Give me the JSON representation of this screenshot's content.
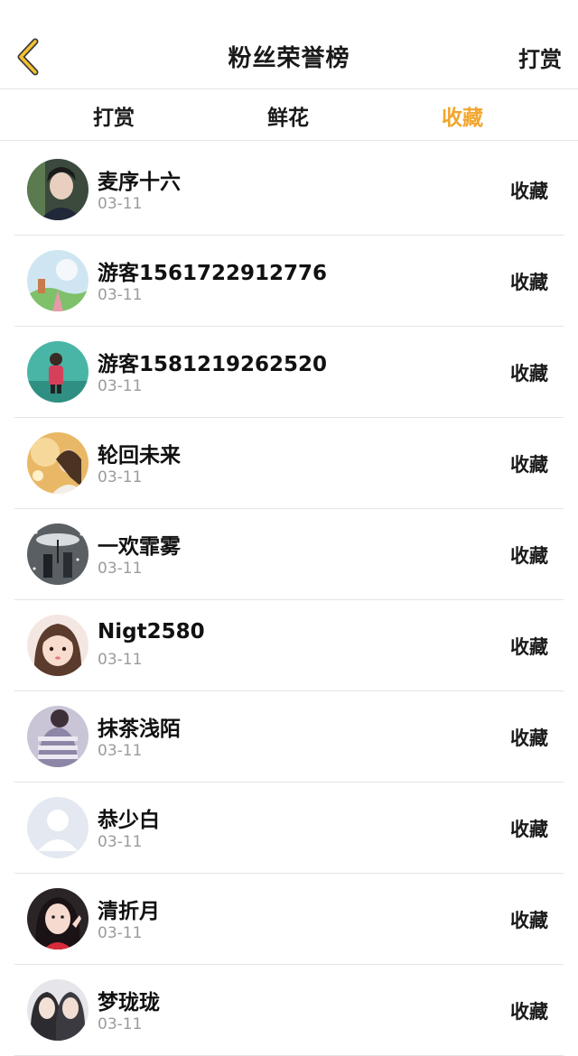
{
  "nav": {
    "title": "粉丝荣誉榜",
    "right_label": "打赏",
    "accent": "#f2a62d"
  },
  "tabs": [
    {
      "label": "打赏"
    },
    {
      "label": "鲜花"
    },
    {
      "label": "收藏"
    }
  ],
  "active_tab": 2,
  "fans": [
    {
      "name": "麦序十六",
      "date": "03-11",
      "action": "收藏"
    },
    {
      "name": "游客1561722912776",
      "date": "03-11",
      "action": "收藏"
    },
    {
      "name": "游客1581219262520",
      "date": "03-11",
      "action": "收藏"
    },
    {
      "name": "轮回未来",
      "date": "03-11",
      "action": "收藏"
    },
    {
      "name": "一欢霏雾",
      "date": "03-11",
      "action": "收藏"
    },
    {
      "name": "Nigt2580",
      "date": "03-11",
      "action": "收藏"
    },
    {
      "name": "抹茶浅陌",
      "date": "03-11",
      "action": "收藏"
    },
    {
      "name": "恭少白",
      "date": "03-11",
      "action": "收藏"
    },
    {
      "name": "清折月",
      "date": "03-11",
      "action": "收藏"
    },
    {
      "name": "梦珑珑",
      "date": "03-11",
      "action": "收藏"
    }
  ]
}
